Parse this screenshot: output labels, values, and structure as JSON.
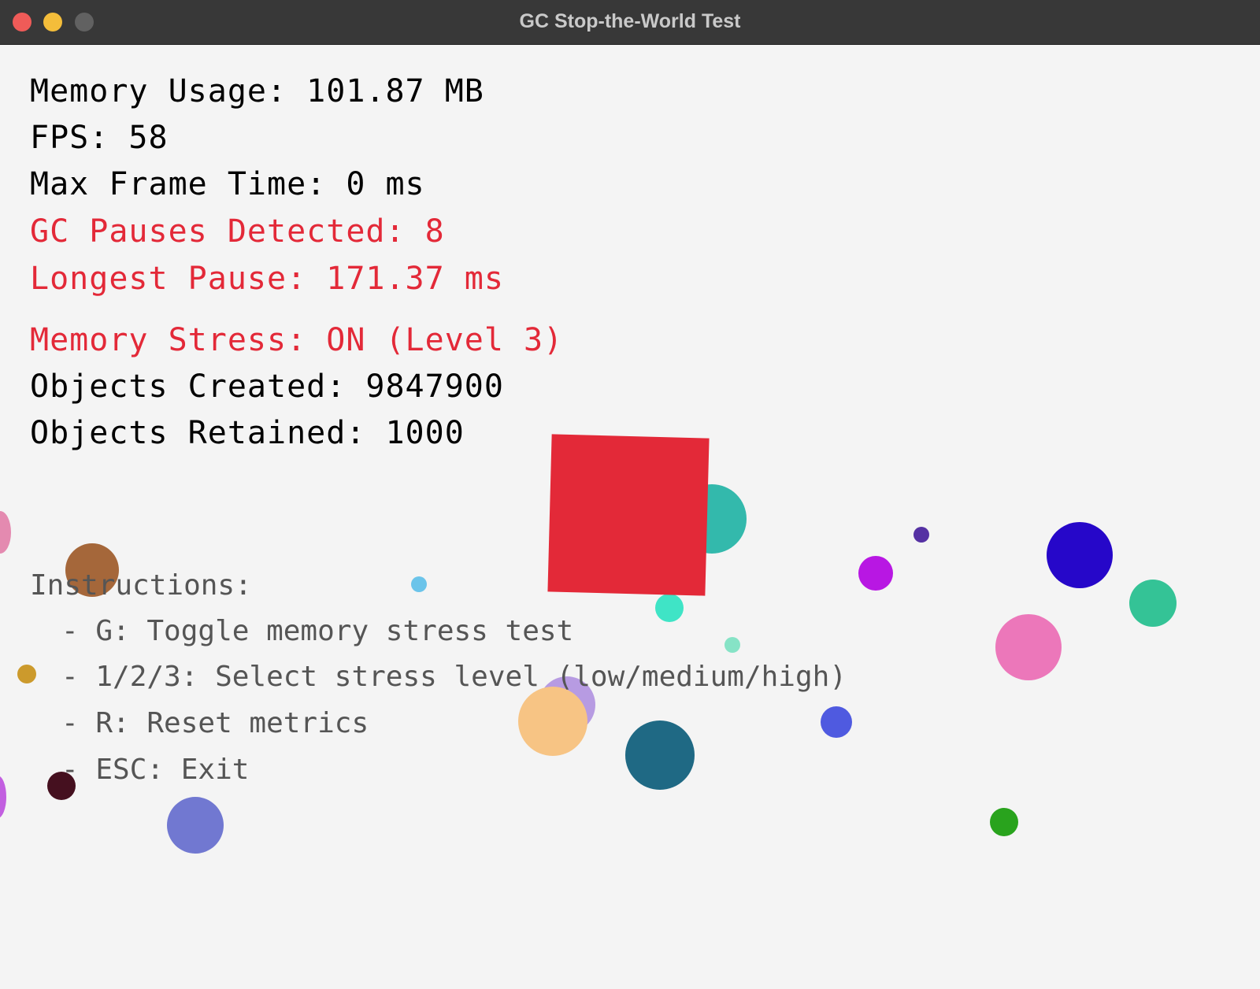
{
  "window": {
    "title": "GC Stop-the-World Test"
  },
  "stats": {
    "memory_usage": "Memory Usage: 101.87 MB",
    "fps": "FPS: 58",
    "max_frame_time": "Max Frame Time: 0 ms",
    "gc_pauses": "GC Pauses Detected: 8",
    "longest_pause": "Longest Pause: 171.37 ms",
    "memory_stress": "Memory Stress: ON (Level 3)",
    "objects_created": "Objects Created: 9847900",
    "objects_retained": "Objects Retained: 1000"
  },
  "colors": {
    "warning_text": "#e32938",
    "normal_text": "#000000",
    "instruction_text": "#555555",
    "square": "#e32938",
    "background": "#f4f4f4"
  },
  "instructions": {
    "heading": "Instructions:",
    "items": [
      "- G: Toggle memory stress test",
      "- 1/2/3: Select stress level (low/medium/high)",
      "- R: Reset metrics",
      "- ESC: Exit"
    ]
  }
}
